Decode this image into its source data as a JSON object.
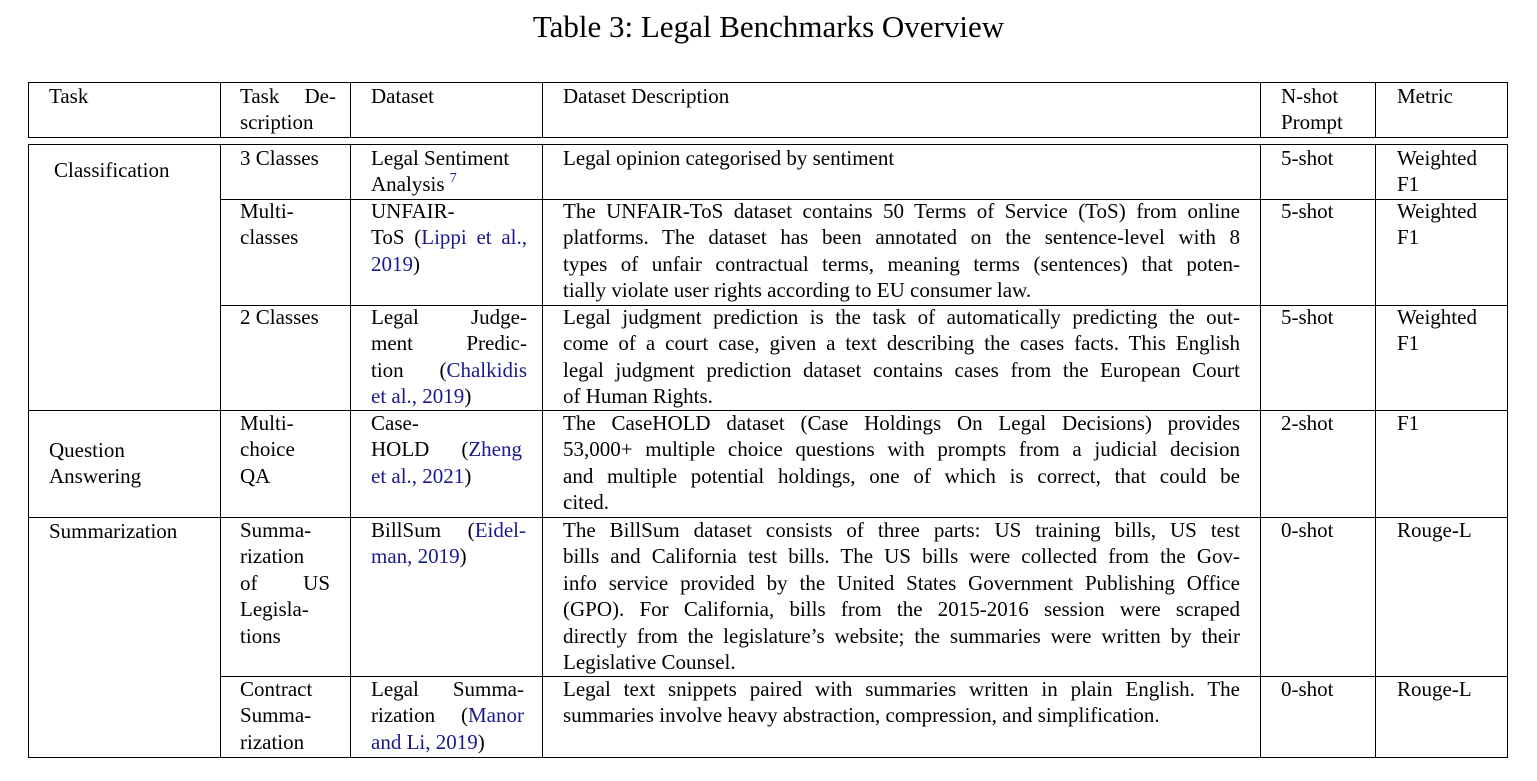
{
  "caption": "Table 3: Legal Benchmarks Overview",
  "header": {
    "task": "Task",
    "task_desc_1": "Task De-",
    "task_desc_2": "scription",
    "dataset": "Dataset",
    "dataset_desc": "Dataset Description",
    "nshot_1": "N-shot",
    "nshot_2": "Prompt",
    "metric": "Metric"
  },
  "groups": {
    "classification": "Classification",
    "qa_1": "Question",
    "qa_2": "Answering",
    "summarization": "Summarization"
  },
  "rows": {
    "r1": {
      "task_desc": "3 Classes",
      "dataset_l1": "Legal Sentiment",
      "dataset_l2": "Analysis",
      "footnote": "7",
      "desc": "Legal opinion categorised by sentiment",
      "nshot": "5-shot",
      "metric_1": "Weighted",
      "metric_2": "F1"
    },
    "r2": {
      "task_desc_1": "Multi-",
      "task_desc_2": "classes",
      "dataset_l1": "UNFAIR-",
      "dataset_l2a": "ToS (",
      "dataset_cite_a": "Lippi et al.,",
      "dataset_cite_b": "2019",
      "dataset_l3b": ")",
      "desc_1": "The UNFAIR-ToS dataset contains 50 Terms of Service (ToS) from online",
      "desc_2": "platforms. The dataset has been annotated on the sentence-level with 8",
      "desc_3": "types of unfair contractual terms, meaning terms (sentences) that poten-",
      "desc_4": "tially violate user rights according to EU consumer law.",
      "nshot": "5-shot",
      "metric_1": "Weighted",
      "metric_2": "F1"
    },
    "r3": {
      "task_desc": "2 Classes",
      "dataset_l1": "Legal Judge-",
      "dataset_l2": "ment Predic-",
      "dataset_l3a": "tion (",
      "dataset_cite_a": "Chalkidis",
      "dataset_cite_b": "et al., 2019",
      "dataset_l4b": ")",
      "desc_1": "Legal judgment prediction is the task of automatically predicting the out-",
      "desc_2": "come of a court case, given a text describing the cases facts. This English",
      "desc_3": "legal judgment prediction dataset contains cases from the European Court",
      "desc_4": "of Human Rights.",
      "nshot": "5-shot",
      "metric_1": "Weighted",
      "metric_2": "F1"
    },
    "r4": {
      "task_desc_1": "Multi-",
      "task_desc_2": "choice",
      "task_desc_3": "QA",
      "dataset_l1": "Case-",
      "dataset_l2a": "HOLD (",
      "dataset_cite_a": "Zheng",
      "dataset_cite_b": "et al., 2021",
      "dataset_l3b": ")",
      "desc_1": "The CaseHOLD dataset (Case Holdings On Legal Decisions) provides",
      "desc_2": "53,000+ multiple choice questions with prompts from a judicial decision",
      "desc_3": "and multiple potential holdings, one of which is correct, that could be",
      "desc_4": "cited.",
      "nshot": "2-shot",
      "metric_1": "F1"
    },
    "r5": {
      "task_desc_1": "Summa-",
      "task_desc_2": "rization",
      "task_desc_3": "of US",
      "task_desc_4": "Legisla-",
      "task_desc_5": "tions",
      "dataset_l1a": "BillSum (",
      "dataset_cite_a": "Eidel-",
      "dataset_cite_b": "man, 2019",
      "dataset_l2b": ")",
      "desc_1": "The BillSum dataset consists of three parts: US training bills, US test",
      "desc_2": "bills and California test bills. The US bills were collected from the Gov-",
      "desc_3": "info service provided by the United States Government Publishing Office",
      "desc_4": "(GPO). For California, bills from the 2015-2016 session were scraped",
      "desc_5": "directly from the legislature’s website; the summaries were written by their",
      "desc_6": "Legislative Counsel.",
      "nshot": "0-shot",
      "metric_1": "Rouge-L"
    },
    "r6": {
      "task_desc_1": "Contract",
      "task_desc_2": "Summa-",
      "task_desc_3": "rization",
      "dataset_l1": "Legal Summa-",
      "dataset_l2a": "rization (",
      "dataset_cite_a": "Manor",
      "dataset_cite_b": "and Li, 2019",
      "dataset_l3b": ")",
      "desc_1": "Legal text snippets paired with summaries written in plain English. The",
      "desc_2": "summaries involve heavy abstraction, compression, and simplification.",
      "nshot": "0-shot",
      "metric_1": "Rouge-L"
    }
  }
}
